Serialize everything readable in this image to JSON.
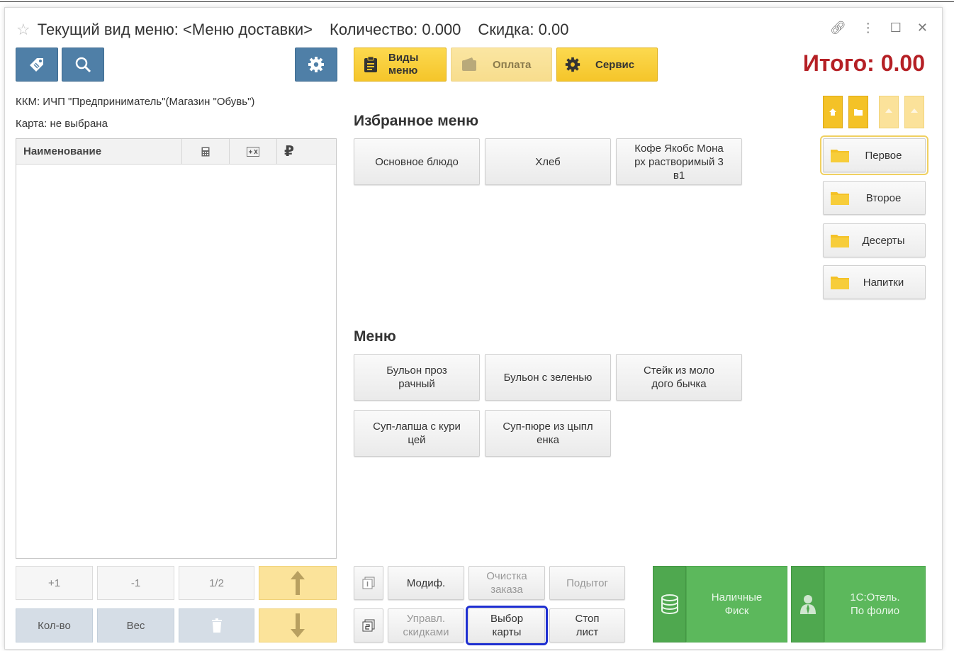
{
  "title": {
    "menu_view": "Текущий вид меню: <Меню доставки>",
    "quantity": "Количество: 0.000",
    "discount": "Скидка: 0.00"
  },
  "toolbar": {
    "menu_types_label": "Виды меню",
    "payment_label": "Оплата",
    "service_label": "Сервис"
  },
  "total": "Итого: 0.00",
  "info": {
    "kkm": "ККМ: ИЧП \"Предприниматель\"(Магазин \"Обувь\")",
    "card": "Карта: не выбрана"
  },
  "table": {
    "columns": [
      "Наименование"
    ],
    "currency_symbol": "₽"
  },
  "favorites": {
    "title": "Избранное меню",
    "items": [
      "Основное блюдо",
      "Хлеб",
      "Кофе Якобс Мона рх растворимый 3 в1"
    ]
  },
  "menu": {
    "title": "Меню",
    "items": [
      "Бульон проз рачный",
      "Бульон с зеленью",
      "Стейк из моло дого бычка",
      "Суп-лапша с кури цей",
      "Суп-пюре из цыпл енка"
    ]
  },
  "categories": [
    "Первое",
    "Второе",
    "Десерты",
    "Напитки"
  ],
  "qty_buttons": {
    "plus_one": "+1",
    "minus_one": "-1",
    "half": "1/2",
    "quantity": "Кол-во",
    "weight": "Вес"
  },
  "bottom_actions": {
    "modifier": "Модиф.",
    "clear_order": "Очистка заказа",
    "subtotal": "Подытог",
    "discount_mgmt": "Управл. скидками",
    "card_select": "Выбор карты",
    "stop_list": "Стоп лист"
  },
  "payments": {
    "cash": "Наличные Фиск",
    "hotel": "1С:Отель. По фолио"
  },
  "colors": {
    "accent_yellow": "#f5c52a",
    "total_red": "#b52025",
    "green": "#5cb85c",
    "blue": "#4f7fa7",
    "highlight": "#1e2fd0"
  }
}
